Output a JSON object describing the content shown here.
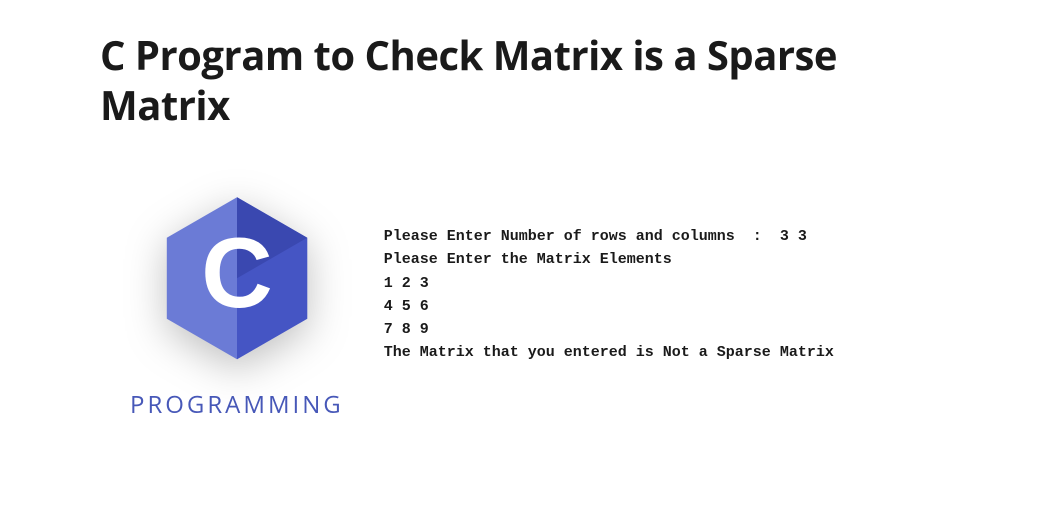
{
  "title": "C Program to Check Matrix is a Sparse Matrix",
  "logo": {
    "letter": "C",
    "label": "PROGRAMMING",
    "colors": {
      "hexagon_light": "#6b7bd6",
      "hexagon_dark": "#3f4db3",
      "letter_color": "#ffffff",
      "label_color": "#4758b8"
    }
  },
  "console": {
    "lines": "Please Enter Number of rows and columns  :  3 3\nPlease Enter the Matrix Elements\n1 2 3\n4 5 6\n7 8 9\nThe Matrix that you entered is Not a Sparse Matrix"
  }
}
